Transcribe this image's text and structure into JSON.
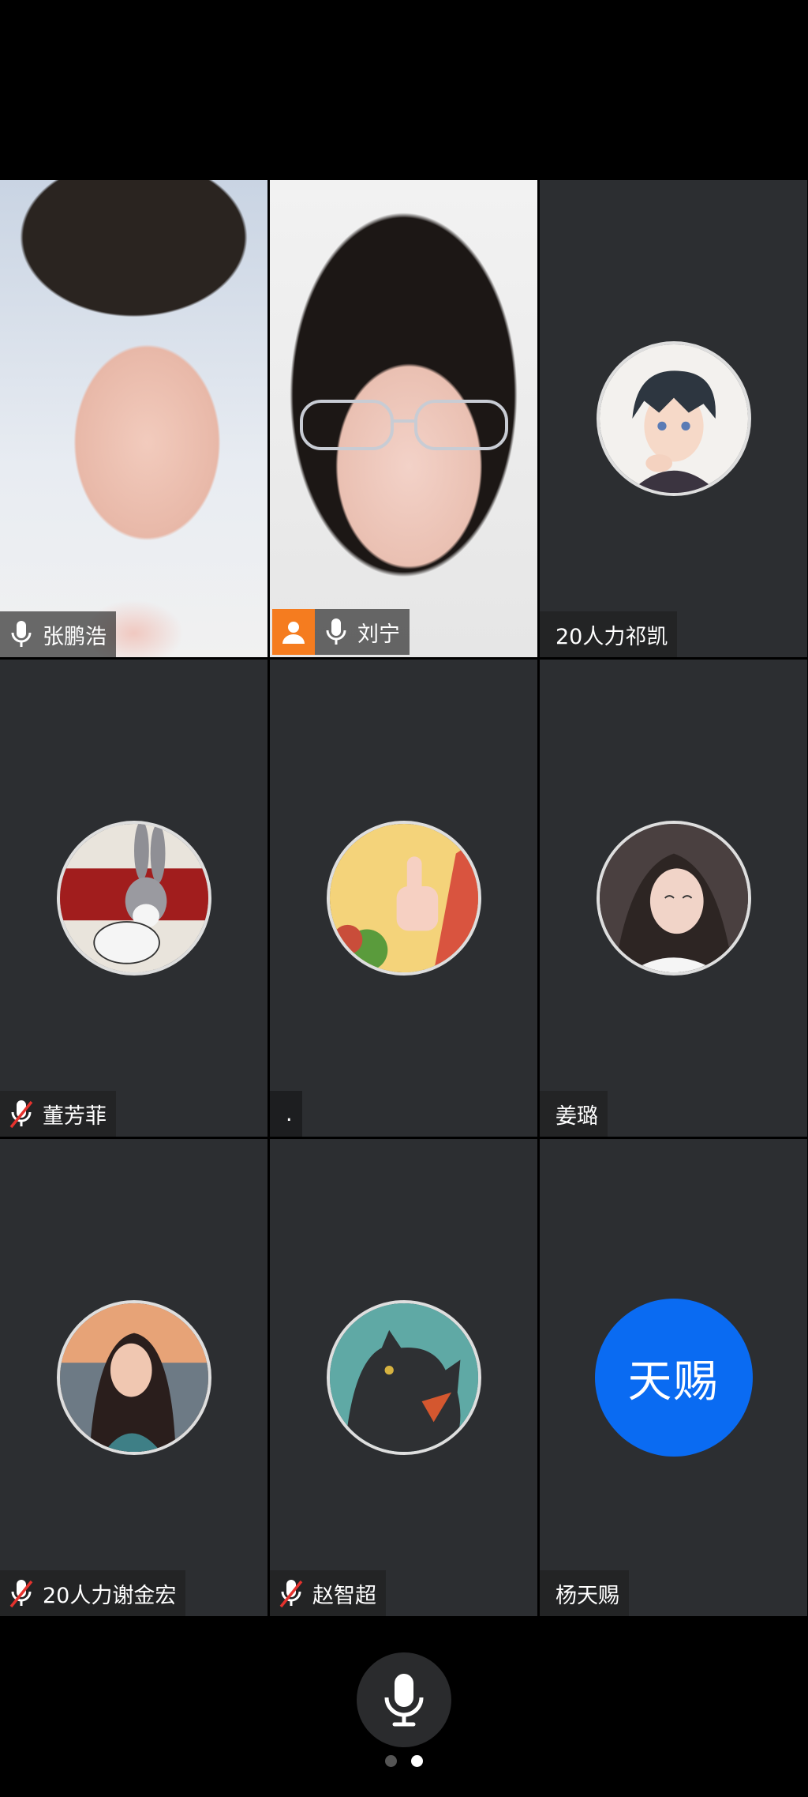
{
  "participants": [
    {
      "name": "张鹏浩",
      "mic": "on",
      "type": "video"
    },
    {
      "name": "刘宁",
      "mic": "on",
      "type": "video",
      "host": true,
      "active": true
    },
    {
      "name": "20人力祁凯",
      "mic": "none",
      "type": "avatar",
      "avatar_icon": "anime-boy-avatar"
    },
    {
      "name": "董芳菲",
      "mic": "muted",
      "type": "avatar",
      "avatar_icon": "rabbit-cartoon-avatar"
    },
    {
      "name": ".",
      "mic": "none",
      "type": "avatar",
      "avatar_icon": "thumbs-up-avatar"
    },
    {
      "name": "姜璐",
      "mic": "none",
      "type": "avatar",
      "avatar_icon": "girl-photo-avatar"
    },
    {
      "name": "20人力谢金宏",
      "mic": "muted",
      "type": "avatar",
      "avatar_icon": "woman-sunset-avatar"
    },
    {
      "name": "赵智超",
      "mic": "muted",
      "type": "avatar",
      "avatar_icon": "black-cat-avatar"
    },
    {
      "name": "杨天赐",
      "mic": "none",
      "type": "initials",
      "initials": "天赐"
    }
  ],
  "colors": {
    "tile_bg": "#2c2e31",
    "active_border": "#1fb85a",
    "host_badge": "#f57c1f",
    "initials_bg": "#0a6bf2",
    "muted_red": "#e5322d"
  },
  "controls": {
    "mic_button_icon": "microphone-icon"
  },
  "pager": {
    "total": 2,
    "current": 2
  }
}
